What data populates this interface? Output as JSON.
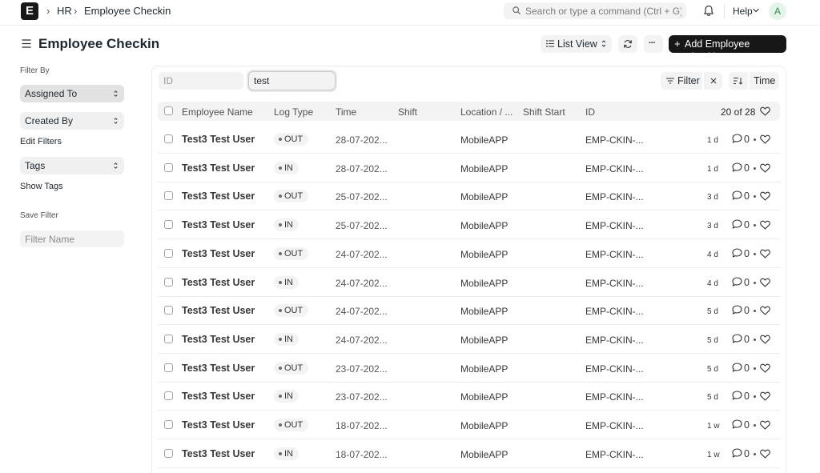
{
  "navbar": {
    "logo": "E",
    "breadcrumbs": [
      "HR",
      "Employee Checkin"
    ],
    "search_placeholder": "Search or type a command (Ctrl + G)",
    "help_label": "Help",
    "avatar_initial": "A"
  },
  "page": {
    "title": "Employee Checkin",
    "view_label": "List View",
    "more_label": "···",
    "add_label": "Add Employee Checkin"
  },
  "sidebar": {
    "filter_by_label": "Filter By",
    "assigned_to": "Assigned To",
    "created_by": "Created By",
    "edit_filters": "Edit Filters",
    "tags": "Tags",
    "show_tags": "Show Tags",
    "save_filter_label": "Save Filter",
    "filter_name_placeholder": "Filter Name"
  },
  "filters": {
    "id_placeholder": "ID",
    "text_value": "test",
    "filter_label": "Filter",
    "sort_field": "Time"
  },
  "table": {
    "columns": [
      "Employee Name",
      "Log Type",
      "Time",
      "Shift",
      "Location / ...",
      "Shift Start",
      "ID"
    ],
    "count": "20 of 28",
    "rows": [
      {
        "name": "Test3 Test User",
        "log_type": "OUT",
        "time": "28-07-202...",
        "location": "MobileAPP",
        "id": "EMP-CKIN-...",
        "modified": "1 d",
        "comments": "0"
      },
      {
        "name": "Test3 Test User",
        "log_type": "IN",
        "time": "28-07-202...",
        "location": "MobileAPP",
        "id": "EMP-CKIN-...",
        "modified": "1 d",
        "comments": "0"
      },
      {
        "name": "Test3 Test User",
        "log_type": "OUT",
        "time": "25-07-202...",
        "location": "MobileAPP",
        "id": "EMP-CKIN-...",
        "modified": "3 d",
        "comments": "0"
      },
      {
        "name": "Test3 Test User",
        "log_type": "IN",
        "time": "25-07-202...",
        "location": "MobileAPP",
        "id": "EMP-CKIN-...",
        "modified": "3 d",
        "comments": "0"
      },
      {
        "name": "Test3 Test User",
        "log_type": "OUT",
        "time": "24-07-202...",
        "location": "MobileAPP",
        "id": "EMP-CKIN-...",
        "modified": "4 d",
        "comments": "0"
      },
      {
        "name": "Test3 Test User",
        "log_type": "IN",
        "time": "24-07-202...",
        "location": "MobileAPP",
        "id": "EMP-CKIN-...",
        "modified": "4 d",
        "comments": "0"
      },
      {
        "name": "Test3 Test User",
        "log_type": "OUT",
        "time": "24-07-202...",
        "location": "MobileAPP",
        "id": "EMP-CKIN-...",
        "modified": "5 d",
        "comments": "0"
      },
      {
        "name": "Test3 Test User",
        "log_type": "IN",
        "time": "24-07-202...",
        "location": "MobileAPP",
        "id": "EMP-CKIN-...",
        "modified": "5 d",
        "comments": "0"
      },
      {
        "name": "Test3 Test User",
        "log_type": "OUT",
        "time": "23-07-202...",
        "location": "MobileAPP",
        "id": "EMP-CKIN-...",
        "modified": "5 d",
        "comments": "0"
      },
      {
        "name": "Test3 Test User",
        "log_type": "IN",
        "time": "23-07-202...",
        "location": "MobileAPP",
        "id": "EMP-CKIN-...",
        "modified": "5 d",
        "comments": "0"
      },
      {
        "name": "Test3 Test User",
        "log_type": "OUT",
        "time": "18-07-202...",
        "location": "MobileAPP",
        "id": "EMP-CKIN-...",
        "modified": "1 w",
        "comments": "0"
      },
      {
        "name": "Test3 Test User",
        "log_type": "IN",
        "time": "18-07-202...",
        "location": "MobileAPP",
        "id": "EMP-CKIN-...",
        "modified": "1 w",
        "comments": "0"
      }
    ]
  }
}
